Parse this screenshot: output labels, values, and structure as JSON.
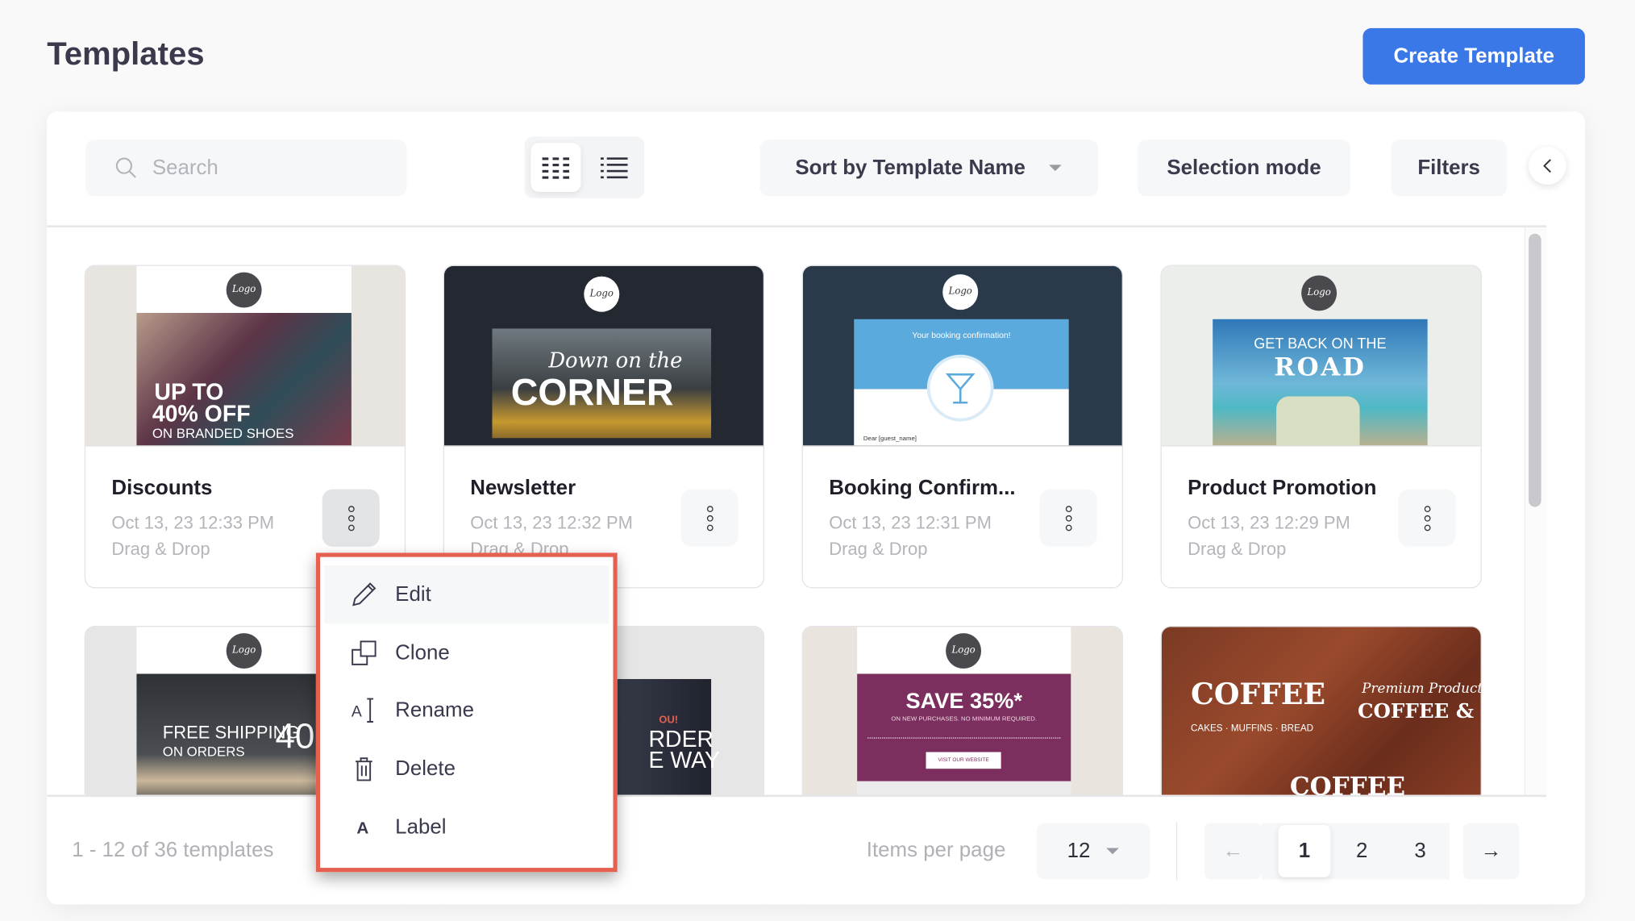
{
  "header": {
    "title": "Templates",
    "create_label": "Create Template"
  },
  "toolbar": {
    "search_placeholder": "Search",
    "sort_label": "Sort by Template Name",
    "selection_label": "Selection mode",
    "filters_label": "Filters",
    "view_active": "grid"
  },
  "colors": {
    "accent": "#3b78e7",
    "menu_highlight_border": "#e5604f"
  },
  "cards": [
    {
      "title": "Discounts",
      "date": "Oct 13, 23 12:33 PM",
      "type": "Drag & Drop",
      "thumb": {
        "logo": "Logo",
        "l1": "UP TO",
        "l2": "40% OFF",
        "l3": "ON BRANDED SHOES"
      }
    },
    {
      "title": "Newsletter",
      "date": "Oct 13, 23 12:32 PM",
      "type": "Drag & Drop",
      "thumb": {
        "logo": "Logo",
        "l1": "Down on the",
        "l2": "CORNER"
      }
    },
    {
      "title": "Booking Confirm...",
      "date": "Oct 13, 23 12:31 PM",
      "type": "Drag & Drop",
      "thumb": {
        "logo": "Logo",
        "l1": "Your booking confirmation!",
        "l2": "Dear [guest_name]"
      }
    },
    {
      "title": "Product Promotion",
      "date": "Oct 13, 23 12:29 PM",
      "type": "Drag & Drop",
      "thumb": {
        "logo": "Logo",
        "l1": "GET BACK ON THE",
        "l2": "ROAD"
      }
    },
    {
      "thumb": {
        "logo": "Logo",
        "l1": "FREE SHIPPING",
        "l2": "ON ORDERS",
        "l3": "40"
      }
    },
    {
      "thumb": {
        "l1": "OU!",
        "l2": "RDER",
        "l3": "E WAY"
      }
    },
    {
      "thumb": {
        "logo": "Logo",
        "l1": "SAVE 35%*",
        "l2": "ON NEW PURCHASES. NO MINIMUM REQUIRED.",
        "l3": "VISIT OUR WEBSITE"
      }
    },
    {
      "thumb": {
        "l1": "COFFEE",
        "l2": "CAKES · MUFFINS · BREAD",
        "l3": "Premium Product",
        "l4": "COFFEE & BAKERY",
        "l5": "COFFEE"
      }
    }
  ],
  "context_menu": {
    "items": [
      {
        "label": "Edit",
        "icon": "pencil-icon"
      },
      {
        "label": "Clone",
        "icon": "clone-icon"
      },
      {
        "label": "Rename",
        "icon": "rename-icon"
      },
      {
        "label": "Delete",
        "icon": "trash-icon"
      },
      {
        "label": "Label",
        "icon": "label-icon"
      }
    ]
  },
  "footer": {
    "summary": "1 - 12 of 36 templates",
    "items_per_page_label": "Items per page",
    "items_per_page_value": "12",
    "pages": [
      "1",
      "2",
      "3"
    ],
    "current_page": "1",
    "prev": "←",
    "next": "→"
  }
}
